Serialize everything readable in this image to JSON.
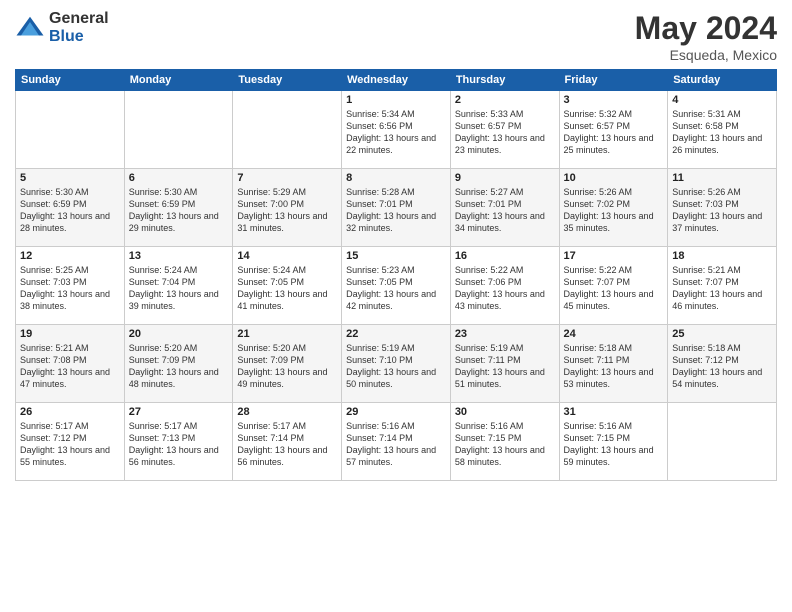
{
  "logo": {
    "general": "General",
    "blue": "Blue"
  },
  "title": {
    "month_year": "May 2024",
    "location": "Esqueda, Mexico"
  },
  "days_of_week": [
    "Sunday",
    "Monday",
    "Tuesday",
    "Wednesday",
    "Thursday",
    "Friday",
    "Saturday"
  ],
  "weeks": [
    [
      {
        "day": "",
        "sunrise": "",
        "sunset": "",
        "daylight": "",
        "empty": true
      },
      {
        "day": "",
        "sunrise": "",
        "sunset": "",
        "daylight": "",
        "empty": true
      },
      {
        "day": "",
        "sunrise": "",
        "sunset": "",
        "daylight": "",
        "empty": true
      },
      {
        "day": "1",
        "sunrise": "Sunrise: 5:34 AM",
        "sunset": "Sunset: 6:56 PM",
        "daylight": "Daylight: 13 hours and 22 minutes.",
        "empty": false
      },
      {
        "day": "2",
        "sunrise": "Sunrise: 5:33 AM",
        "sunset": "Sunset: 6:57 PM",
        "daylight": "Daylight: 13 hours and 23 minutes.",
        "empty": false
      },
      {
        "day": "3",
        "sunrise": "Sunrise: 5:32 AM",
        "sunset": "Sunset: 6:57 PM",
        "daylight": "Daylight: 13 hours and 25 minutes.",
        "empty": false
      },
      {
        "day": "4",
        "sunrise": "Sunrise: 5:31 AM",
        "sunset": "Sunset: 6:58 PM",
        "daylight": "Daylight: 13 hours and 26 minutes.",
        "empty": false
      }
    ],
    [
      {
        "day": "5",
        "sunrise": "Sunrise: 5:30 AM",
        "sunset": "Sunset: 6:59 PM",
        "daylight": "Daylight: 13 hours and 28 minutes.",
        "empty": false
      },
      {
        "day": "6",
        "sunrise": "Sunrise: 5:30 AM",
        "sunset": "Sunset: 6:59 PM",
        "daylight": "Daylight: 13 hours and 29 minutes.",
        "empty": false
      },
      {
        "day": "7",
        "sunrise": "Sunrise: 5:29 AM",
        "sunset": "Sunset: 7:00 PM",
        "daylight": "Daylight: 13 hours and 31 minutes.",
        "empty": false
      },
      {
        "day": "8",
        "sunrise": "Sunrise: 5:28 AM",
        "sunset": "Sunset: 7:01 PM",
        "daylight": "Daylight: 13 hours and 32 minutes.",
        "empty": false
      },
      {
        "day": "9",
        "sunrise": "Sunrise: 5:27 AM",
        "sunset": "Sunset: 7:01 PM",
        "daylight": "Daylight: 13 hours and 34 minutes.",
        "empty": false
      },
      {
        "day": "10",
        "sunrise": "Sunrise: 5:26 AM",
        "sunset": "Sunset: 7:02 PM",
        "daylight": "Daylight: 13 hours and 35 minutes.",
        "empty": false
      },
      {
        "day": "11",
        "sunrise": "Sunrise: 5:26 AM",
        "sunset": "Sunset: 7:03 PM",
        "daylight": "Daylight: 13 hours and 37 minutes.",
        "empty": false
      }
    ],
    [
      {
        "day": "12",
        "sunrise": "Sunrise: 5:25 AM",
        "sunset": "Sunset: 7:03 PM",
        "daylight": "Daylight: 13 hours and 38 minutes.",
        "empty": false
      },
      {
        "day": "13",
        "sunrise": "Sunrise: 5:24 AM",
        "sunset": "Sunset: 7:04 PM",
        "daylight": "Daylight: 13 hours and 39 minutes.",
        "empty": false
      },
      {
        "day": "14",
        "sunrise": "Sunrise: 5:24 AM",
        "sunset": "Sunset: 7:05 PM",
        "daylight": "Daylight: 13 hours and 41 minutes.",
        "empty": false
      },
      {
        "day": "15",
        "sunrise": "Sunrise: 5:23 AM",
        "sunset": "Sunset: 7:05 PM",
        "daylight": "Daylight: 13 hours and 42 minutes.",
        "empty": false
      },
      {
        "day": "16",
        "sunrise": "Sunrise: 5:22 AM",
        "sunset": "Sunset: 7:06 PM",
        "daylight": "Daylight: 13 hours and 43 minutes.",
        "empty": false
      },
      {
        "day": "17",
        "sunrise": "Sunrise: 5:22 AM",
        "sunset": "Sunset: 7:07 PM",
        "daylight": "Daylight: 13 hours and 45 minutes.",
        "empty": false
      },
      {
        "day": "18",
        "sunrise": "Sunrise: 5:21 AM",
        "sunset": "Sunset: 7:07 PM",
        "daylight": "Daylight: 13 hours and 46 minutes.",
        "empty": false
      }
    ],
    [
      {
        "day": "19",
        "sunrise": "Sunrise: 5:21 AM",
        "sunset": "Sunset: 7:08 PM",
        "daylight": "Daylight: 13 hours and 47 minutes.",
        "empty": false
      },
      {
        "day": "20",
        "sunrise": "Sunrise: 5:20 AM",
        "sunset": "Sunset: 7:09 PM",
        "daylight": "Daylight: 13 hours and 48 minutes.",
        "empty": false
      },
      {
        "day": "21",
        "sunrise": "Sunrise: 5:20 AM",
        "sunset": "Sunset: 7:09 PM",
        "daylight": "Daylight: 13 hours and 49 minutes.",
        "empty": false
      },
      {
        "day": "22",
        "sunrise": "Sunrise: 5:19 AM",
        "sunset": "Sunset: 7:10 PM",
        "daylight": "Daylight: 13 hours and 50 minutes.",
        "empty": false
      },
      {
        "day": "23",
        "sunrise": "Sunrise: 5:19 AM",
        "sunset": "Sunset: 7:11 PM",
        "daylight": "Daylight: 13 hours and 51 minutes.",
        "empty": false
      },
      {
        "day": "24",
        "sunrise": "Sunrise: 5:18 AM",
        "sunset": "Sunset: 7:11 PM",
        "daylight": "Daylight: 13 hours and 53 minutes.",
        "empty": false
      },
      {
        "day": "25",
        "sunrise": "Sunrise: 5:18 AM",
        "sunset": "Sunset: 7:12 PM",
        "daylight": "Daylight: 13 hours and 54 minutes.",
        "empty": false
      }
    ],
    [
      {
        "day": "26",
        "sunrise": "Sunrise: 5:17 AM",
        "sunset": "Sunset: 7:12 PM",
        "daylight": "Daylight: 13 hours and 55 minutes.",
        "empty": false
      },
      {
        "day": "27",
        "sunrise": "Sunrise: 5:17 AM",
        "sunset": "Sunset: 7:13 PM",
        "daylight": "Daylight: 13 hours and 56 minutes.",
        "empty": false
      },
      {
        "day": "28",
        "sunrise": "Sunrise: 5:17 AM",
        "sunset": "Sunset: 7:14 PM",
        "daylight": "Daylight: 13 hours and 56 minutes.",
        "empty": false
      },
      {
        "day": "29",
        "sunrise": "Sunrise: 5:16 AM",
        "sunset": "Sunset: 7:14 PM",
        "daylight": "Daylight: 13 hours and 57 minutes.",
        "empty": false
      },
      {
        "day": "30",
        "sunrise": "Sunrise: 5:16 AM",
        "sunset": "Sunset: 7:15 PM",
        "daylight": "Daylight: 13 hours and 58 minutes.",
        "empty": false
      },
      {
        "day": "31",
        "sunrise": "Sunrise: 5:16 AM",
        "sunset": "Sunset: 7:15 PM",
        "daylight": "Daylight: 13 hours and 59 minutes.",
        "empty": false
      },
      {
        "day": "",
        "sunrise": "",
        "sunset": "",
        "daylight": "",
        "empty": true
      }
    ]
  ]
}
